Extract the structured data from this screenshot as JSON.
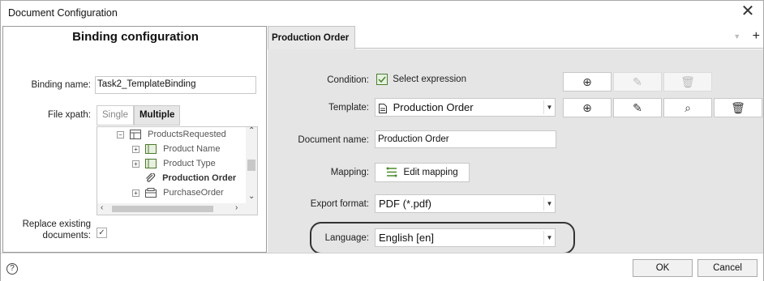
{
  "window": {
    "title": "Document Configuration",
    "close": "✕"
  },
  "left": {
    "heading": "Binding configuration",
    "binding_name_label": "Binding name:",
    "binding_name_value": "Task2_TemplateBinding",
    "file_xpath_label": "File xpath:",
    "toggle_single": "Single",
    "toggle_multiple": "Multiple",
    "tree": [
      {
        "label": "ProductsRequested"
      },
      {
        "label": "Product Name"
      },
      {
        "label": "Product Type"
      },
      {
        "label": "Production Order"
      },
      {
        "label": "PurchaseOrder"
      }
    ],
    "replace_label_1": "Replace existing",
    "replace_label_2": "documents:",
    "replace_checked": "✓"
  },
  "tabs": {
    "active": "Production Order",
    "add": "+"
  },
  "form": {
    "condition_label": "Condition:",
    "condition_value": "Select expression",
    "template_label": "Template:",
    "template_value": "Production Order",
    "docname_label": "Document name:",
    "docname_value": "Production Order",
    "mapping_label": "Mapping:",
    "mapping_button": "Edit mapping",
    "export_label": "Export format:",
    "export_value": "PDF (*.pdf)",
    "language_label": "Language:",
    "language_value": "English [en]"
  },
  "footer": {
    "help": "?",
    "ok": "OK",
    "cancel": "Cancel"
  }
}
